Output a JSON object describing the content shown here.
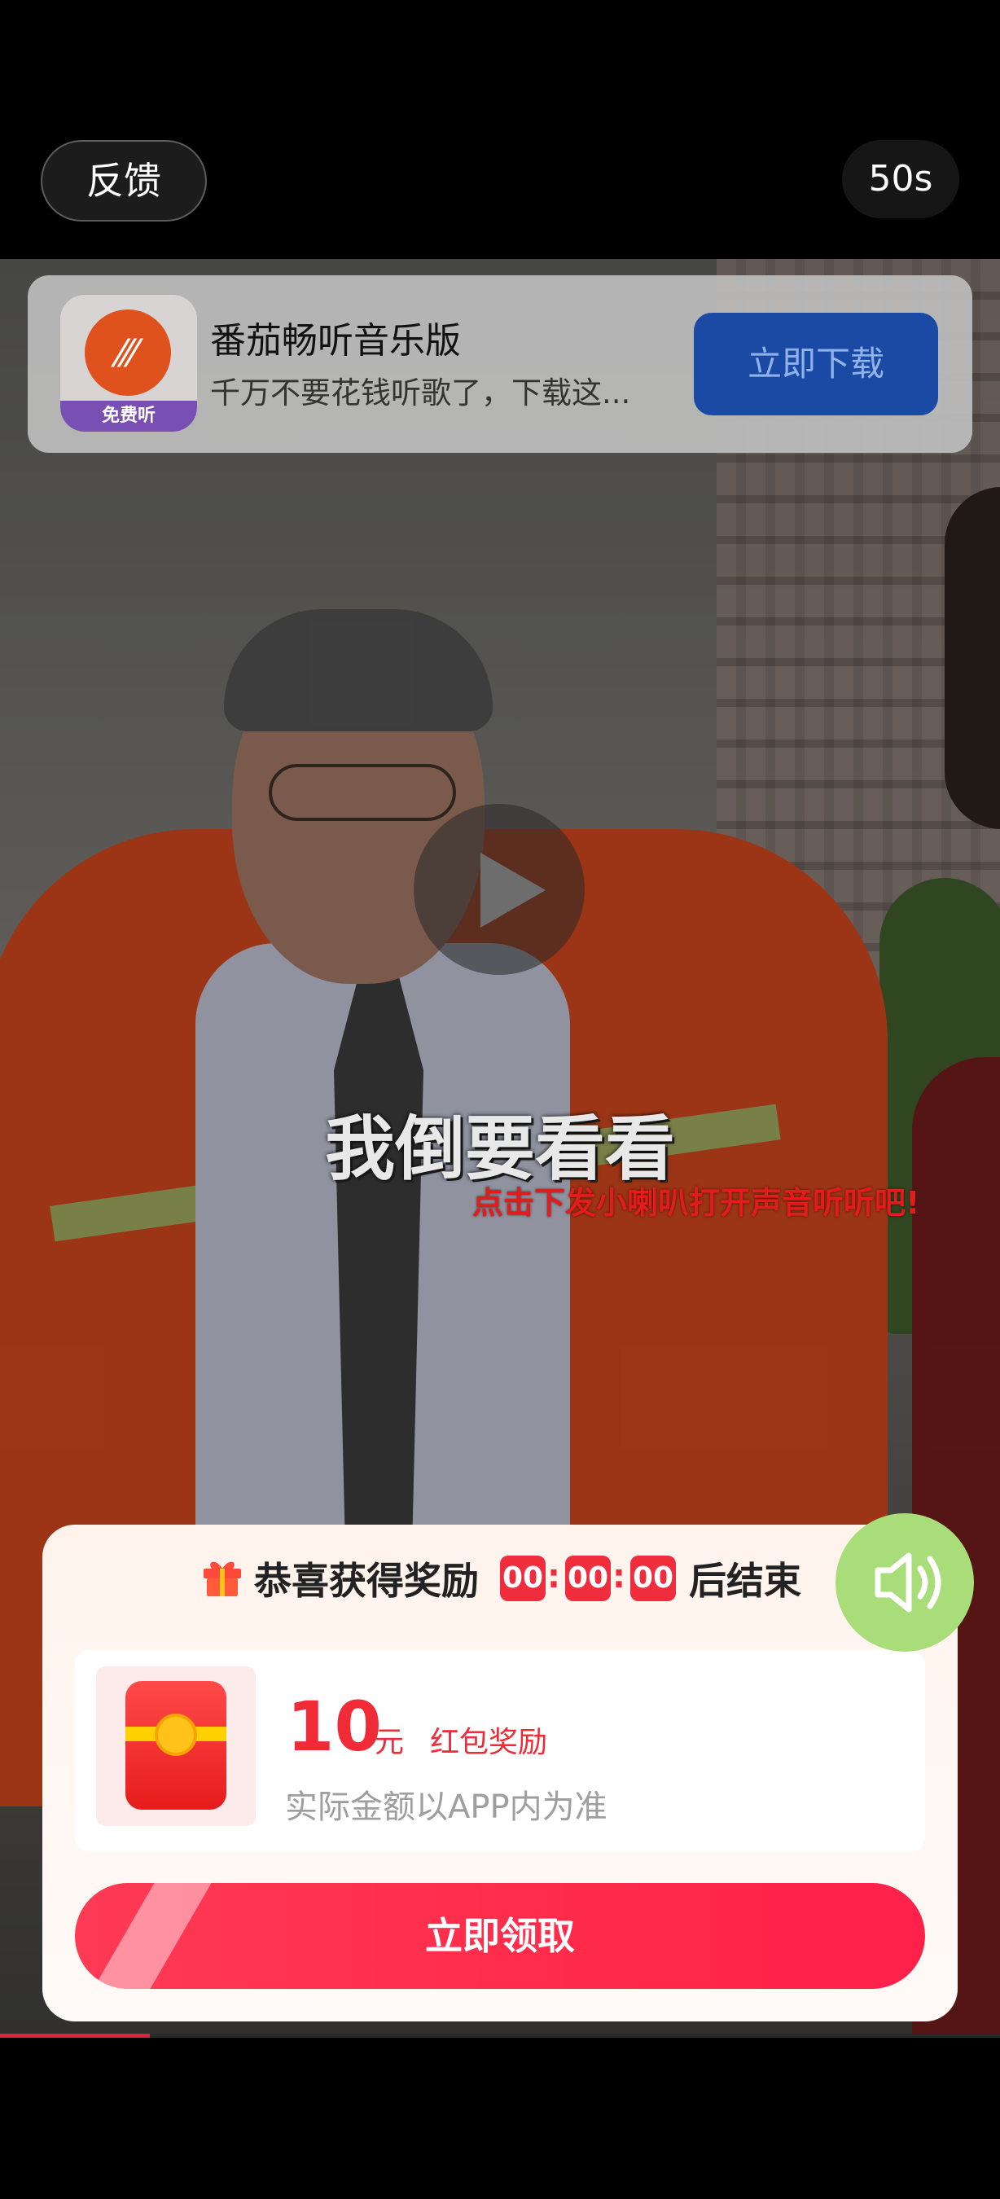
{
  "topbar": {
    "feedback_label": "反馈",
    "countdown": "50s"
  },
  "ad": {
    "icon_tag": "免费听",
    "icon_mark": "⁄⁄⁄",
    "title": "番茄畅听音乐版",
    "description": "千万不要花钱听歌了，下载这...",
    "download_label": "立即下载"
  },
  "video": {
    "subtitle": "我倒要看看",
    "sound_hint": "点击下发小喇叭打开声音听听吧!",
    "progress": 0.15
  },
  "reward": {
    "title": "恭喜获得奖励",
    "timer": [
      "00",
      "00",
      "00"
    ],
    "timer_suffix": "后结束",
    "amount": "10",
    "unit": "元",
    "label": "红包奖励",
    "note": "实际金额以APP内为准",
    "claim_label": "立即领取"
  },
  "colors": {
    "accent": "#f02d3c",
    "claim": "#ff2a4a",
    "download": "#1a4aa3",
    "sound": "#a8dd7a"
  }
}
